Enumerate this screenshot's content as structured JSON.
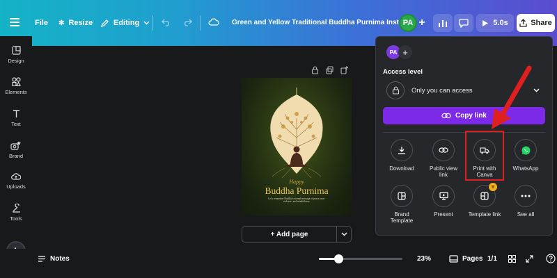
{
  "topbar": {
    "file": "File",
    "resize": "Resize",
    "editing": "Editing",
    "doc_title": "Green and Yellow Traditional Buddha Purnima Inst...",
    "avatar": "PA",
    "timer": "5.0s",
    "share": "Share"
  },
  "sidebar": {
    "items": [
      {
        "label": "Design"
      },
      {
        "label": "Elements"
      },
      {
        "label": "Text"
      },
      {
        "label": "Brand"
      },
      {
        "label": "Uploads"
      },
      {
        "label": "Tools"
      }
    ]
  },
  "poster": {
    "script": "Happy",
    "title": "Buddha Purnima",
    "body": "Let's remember Buddha's eternal message of peace, non-violence, and mindfulness."
  },
  "canvas": {
    "add_page": "+ Add page"
  },
  "bottombar": {
    "notes": "Notes",
    "zoom": "23%",
    "pages": "Pages",
    "page_count": "1/1",
    "zoom_level": 0.23
  },
  "share_panel": {
    "avatar": "PA",
    "access_level_label": "Access level",
    "access_value": "Only you can access",
    "copy_link": "Copy link",
    "options": [
      {
        "label": "Download",
        "icon": "download-icon"
      },
      {
        "label": "Public view link",
        "icon": "link-icon"
      },
      {
        "label": "Print with Canva",
        "icon": "truck-icon"
      },
      {
        "label": "WhatsApp",
        "icon": "whatsapp-icon"
      },
      {
        "label": "Brand Template",
        "icon": "template-icon"
      },
      {
        "label": "Present",
        "icon": "present-icon"
      },
      {
        "label": "Template link",
        "icon": "template-link-icon"
      },
      {
        "label": "See all",
        "icon": "more-icon"
      }
    ]
  },
  "colors": {
    "accent": "#7d2ae8",
    "highlight": "#e02020",
    "whatsapp": "#25d366"
  }
}
